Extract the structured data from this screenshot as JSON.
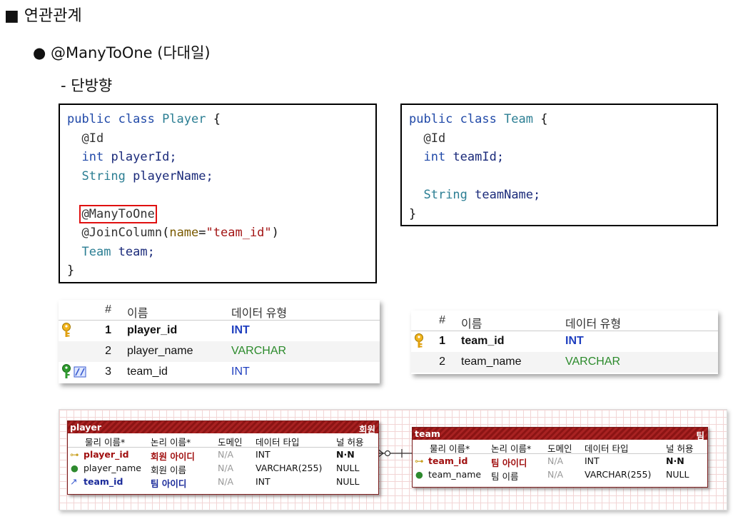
{
  "headings": {
    "h1": "■ 연관관계",
    "h2": "● @ManyToOne (다대일)",
    "h3": "- 단방향"
  },
  "code_player": {
    "l1_kw": "public class ",
    "l1_cls": "Player",
    "l1_end": " {",
    "l2": "@Id",
    "l3_kw": "int ",
    "l3_id": "playerId;",
    "l4_ty": "String ",
    "l4_id": "playerName;",
    "l6": "@ManyToOne",
    "l7_ann": "@JoinColumn",
    "l7_open": "(",
    "l7_attr": "name",
    "l7_eq": "=",
    "l7_str": "\"team_id\"",
    "l7_close": ")",
    "l8_ty": "Team ",
    "l8_id": "team;",
    "l9": "}"
  },
  "code_team": {
    "l1_kw": "public class ",
    "l1_cls": "Team",
    "l1_end": " {",
    "l2": "@Id",
    "l3_kw": "int ",
    "l3_id": "teamId;",
    "l5_ty": "String ",
    "l5_id": "teamName;",
    "l6": "}"
  },
  "table_player": {
    "headers": [
      "#",
      "이름",
      "데이터 유형"
    ],
    "rows": [
      {
        "n": "1",
        "name": "player_id",
        "type": "INT",
        "icon": "primary-key-icon"
      },
      {
        "n": "2",
        "name": "player_name",
        "type": "VARCHAR",
        "icon": ""
      },
      {
        "n": "3",
        "name": "team_id",
        "type": "INT",
        "icon": "foreign-key-icon"
      }
    ]
  },
  "table_team": {
    "headers": [
      "#",
      "이름",
      "데이터 유형"
    ],
    "rows": [
      {
        "n": "1",
        "name": "team_id",
        "type": "INT",
        "icon": "primary-key-icon"
      },
      {
        "n": "2",
        "name": "team_name",
        "type": "VARCHAR",
        "icon": ""
      }
    ]
  },
  "erd_player": {
    "title": "player",
    "title_kr": "회원",
    "columns": [
      "물리 이름*",
      "논리 이름*",
      "도메인",
      "데이터 타입",
      "널 허용"
    ],
    "rows": [
      [
        "player_id",
        "회원 아이디",
        "N/A",
        "INT",
        "N·N"
      ],
      [
        "player_name",
        "회원 이름",
        "N/A",
        "VARCHAR(255)",
        "NULL"
      ],
      [
        "team_id",
        "팀 아이디",
        "N/A",
        "INT",
        "NULL"
      ]
    ]
  },
  "erd_team": {
    "title": "team",
    "title_kr": "팀",
    "columns": [
      "물리 이름*",
      "논리 이름*",
      "도메인",
      "데이터 타입",
      "널 허용"
    ],
    "rows": [
      [
        "team_id",
        "팀 아이디",
        "N/A",
        "INT",
        "N·N"
      ],
      [
        "team_name",
        "팀 이름",
        "N/A",
        "VARCHAR(255)",
        "NULL"
      ]
    ]
  },
  "colors": {
    "highlight": "#e01010",
    "pk": "#a01010",
    "fk": "#1a2a9a",
    "entity_header": "#8c1414"
  }
}
